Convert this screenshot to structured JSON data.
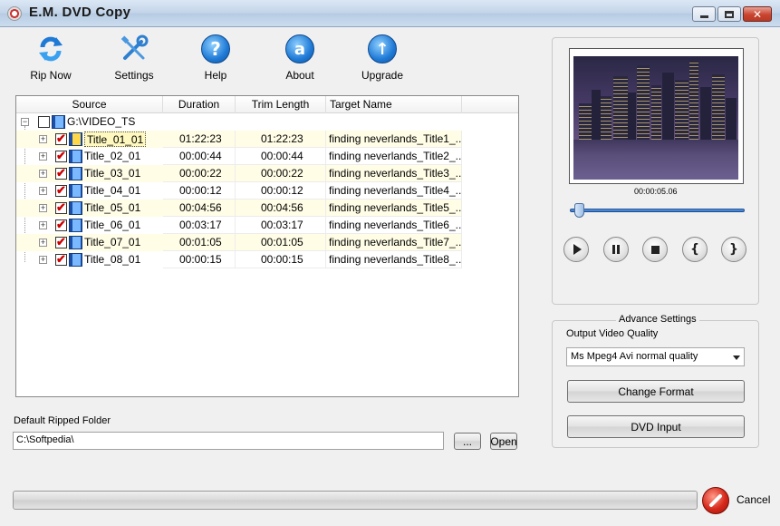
{
  "window": {
    "title": "E.M. DVD Copy"
  },
  "toolbar": {
    "rip_now": "Rip Now",
    "settings": "Settings",
    "help": "Help",
    "about": "About",
    "upgrade": "Upgrade"
  },
  "grid": {
    "columns": [
      "Source",
      "Duration",
      "Trim Length",
      "Target Name"
    ],
    "root": "G:\\VIDEO_TS",
    "rows": [
      {
        "name": "Title_01_01",
        "duration": "01:22:23",
        "trim": "01:22:23",
        "target": "finding neverlands_Title1_..."
      },
      {
        "name": "Title_02_01",
        "duration": "00:00:44",
        "trim": "00:00:44",
        "target": "finding neverlands_Title2_..."
      },
      {
        "name": "Title_03_01",
        "duration": "00:00:22",
        "trim": "00:00:22",
        "target": "finding neverlands_Title3_..."
      },
      {
        "name": "Title_04_01",
        "duration": "00:00:12",
        "trim": "00:00:12",
        "target": "finding neverlands_Title4_..."
      },
      {
        "name": "Title_05_01",
        "duration": "00:04:56",
        "trim": "00:04:56",
        "target": "finding neverlands_Title5_..."
      },
      {
        "name": "Title_06_01",
        "duration": "00:03:17",
        "trim": "00:03:17",
        "target": "finding neverlands_Title6_..."
      },
      {
        "name": "Title_07_01",
        "duration": "00:01:05",
        "trim": "00:01:05",
        "target": "finding neverlands_Title7_..."
      },
      {
        "name": "Title_08_01",
        "duration": "00:00:15",
        "trim": "00:00:15",
        "target": "finding neverlands_Title8_..."
      }
    ]
  },
  "folder": {
    "label": "Default Ripped Folder",
    "value": "C:\\Softpedia\\",
    "browse": "...",
    "open": "Open"
  },
  "player": {
    "timecode": "00:00:05.06",
    "seek_position": 0.03
  },
  "advance": {
    "title": "Advance Settings",
    "quality_label": "Output Video Quality",
    "quality_value": "Ms Mpeg4 Avi normal quality",
    "change_format": "Change Format",
    "dvd_input": "DVD Input"
  },
  "bottom": {
    "progress": 0,
    "cancel": "Cancel"
  }
}
